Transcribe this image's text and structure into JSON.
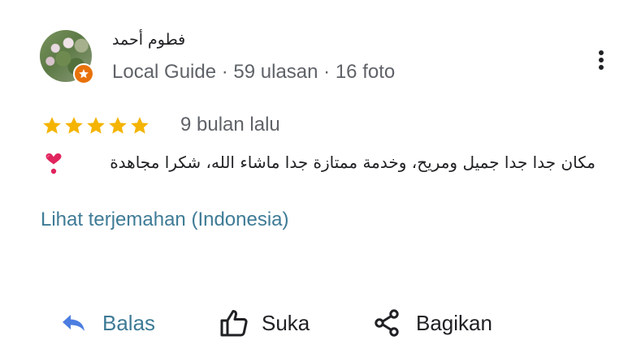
{
  "reviewer": {
    "name": "فطوم أحمد",
    "meta": "Local Guide · 59 ulasan · 16 foto"
  },
  "rating": {
    "stars": 5,
    "max": 5,
    "time": "9 bulan lalu"
  },
  "review": {
    "text": "مكان جدا جدا جميل ومريح، وخدمة ممتازة جدا ماشاء الله، شكرا مجاهدة"
  },
  "translate_link": "Lihat terjemahan (Indonesia)",
  "actions": {
    "reply": "Balas",
    "like": "Suka",
    "share": "Bagikan"
  },
  "colors": {
    "star": "#f4b400",
    "link": "#3e7b96",
    "badge": "#e8710a",
    "heart": "#d81b60"
  },
  "icons": [
    "star-icon",
    "more-vert-icon",
    "heart-icon",
    "reply-icon",
    "thumb-up-icon",
    "share-icon"
  ]
}
